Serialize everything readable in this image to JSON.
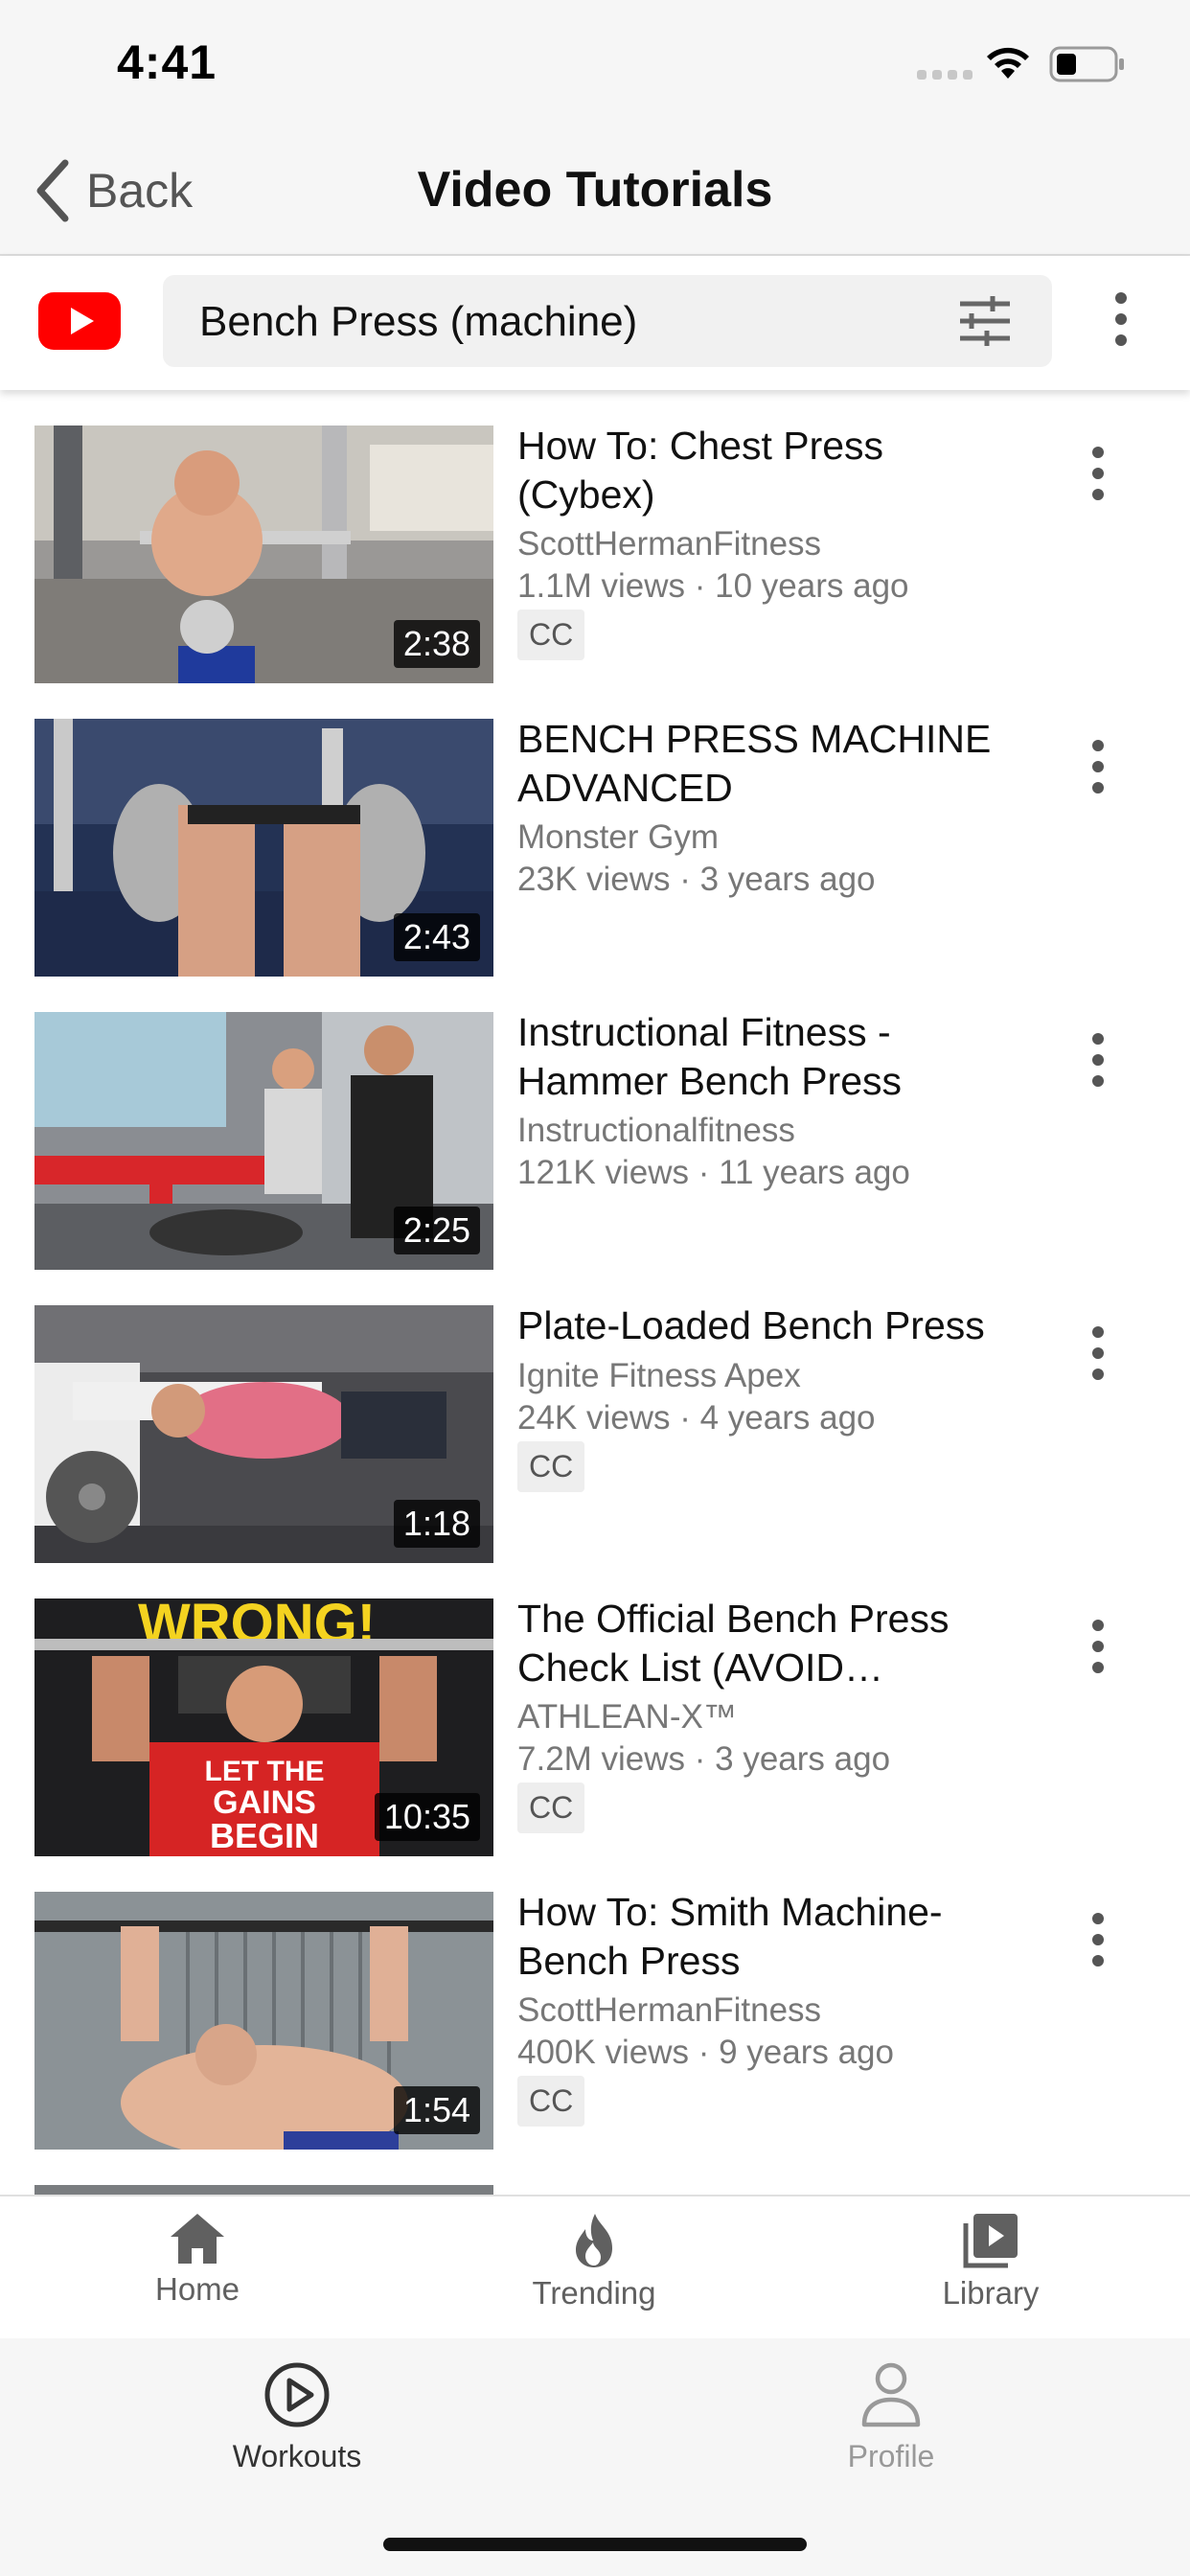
{
  "status_bar": {
    "time": "4:41"
  },
  "nav": {
    "back_label": "Back",
    "title": "Video Tutorials"
  },
  "search": {
    "query": "Bench Press (machine)"
  },
  "videos": [
    {
      "title": "How To: Chest Press (Cybex)",
      "channel": "ScottHermanFitness",
      "meta": "1.1M views · 10 years ago",
      "cc": "CC",
      "duration": "2:38"
    },
    {
      "title": "BENCH PRESS MACHINE ADVANCED",
      "channel": "Monster Gym",
      "meta": "23K views · 3 years ago",
      "cc": "",
      "duration": "2:43"
    },
    {
      "title": "Instructional Fitness - Hammer Bench Press",
      "channel": "Instructionalfitness",
      "meta": "121K views · 11 years ago",
      "cc": "",
      "duration": "2:25"
    },
    {
      "title": "Plate-Loaded Bench Press",
      "channel": "Ignite Fitness Apex",
      "meta": "24K views · 4 years ago",
      "cc": "CC",
      "duration": "1:18"
    },
    {
      "title": "The Official Bench Press Check List (AVOID…",
      "channel": "ATHLEAN-X™",
      "meta": "7.2M views · 3 years ago",
      "cc": "CC",
      "duration": "10:35",
      "thumb_text_top": "WRONG!",
      "thumb_text_shirt_1": "LET THE",
      "thumb_text_shirt_2": "GAINS",
      "thumb_text_shirt_3": "BEGIN"
    },
    {
      "title": "How To: Smith Machine-Bench Press",
      "channel": "ScottHermanFitness",
      "meta": "400K views · 9 years ago",
      "cc": "CC",
      "duration": "1:54"
    }
  ],
  "yt_tabs": [
    {
      "label": "Home",
      "icon": "home-icon"
    },
    {
      "label": "Trending",
      "icon": "flame-icon"
    },
    {
      "label": "Library",
      "icon": "library-icon"
    }
  ],
  "app_tabs": [
    {
      "label": "Workouts",
      "icon": "play-circle-icon",
      "active": true
    },
    {
      "label": "Profile",
      "icon": "person-icon",
      "active": false
    }
  ],
  "colors": {
    "youtube_red": "#ff0000",
    "background": "#f6f6f6"
  }
}
